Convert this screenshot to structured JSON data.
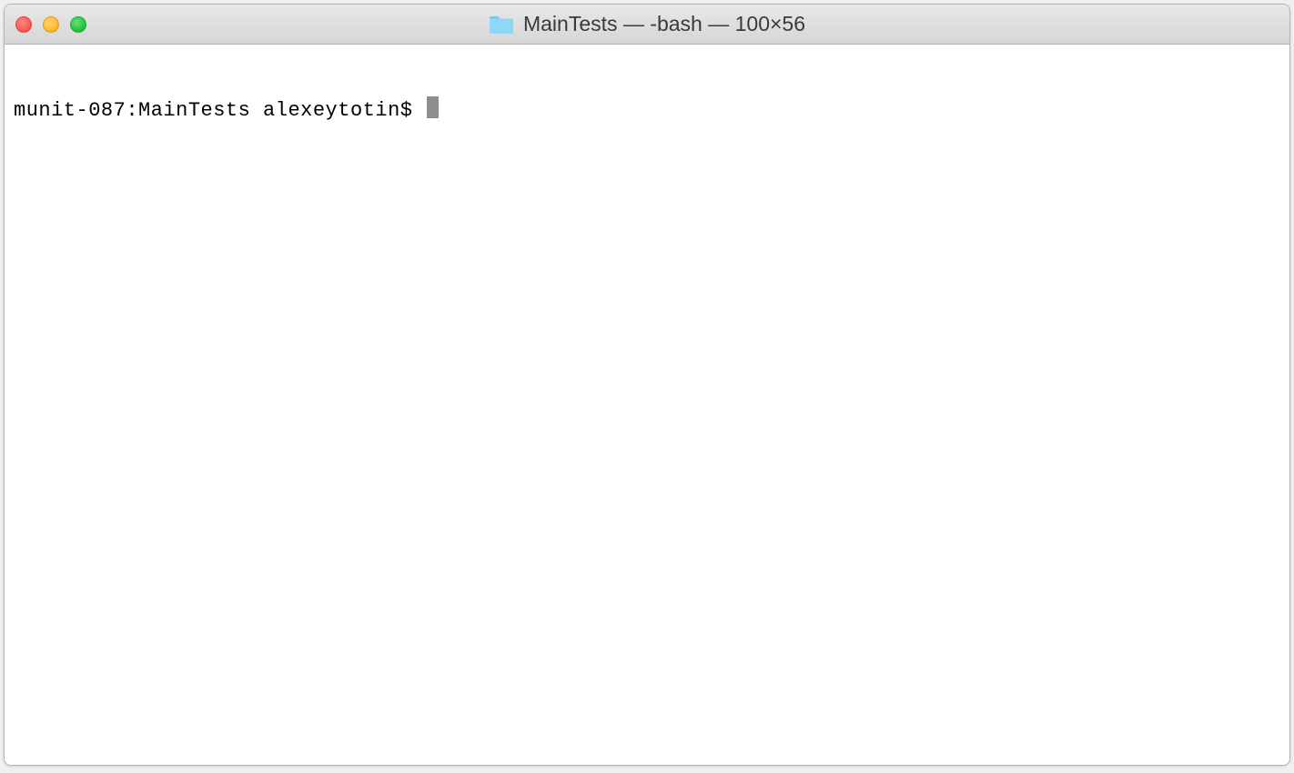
{
  "window": {
    "title": "MainTests — -bash — 100×56"
  },
  "terminal": {
    "prompt": "munit-087:MainTests alexeytotin$ "
  }
}
